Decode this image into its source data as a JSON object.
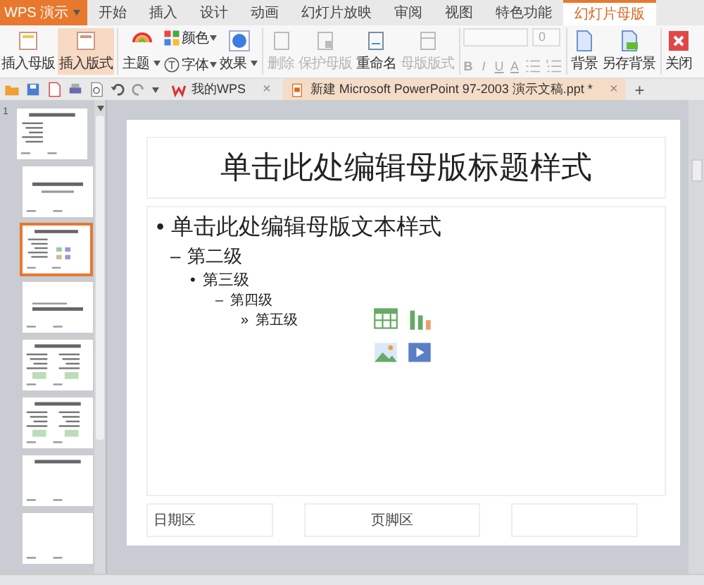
{
  "app_button": {
    "label": "WPS 演示"
  },
  "menu_tabs": [
    {
      "label": "开始",
      "selected": false
    },
    {
      "label": "插入",
      "selected": false
    },
    {
      "label": "设计",
      "selected": false
    },
    {
      "label": "动画",
      "selected": false
    },
    {
      "label": "幻灯片放映",
      "selected": false
    },
    {
      "label": "审阅",
      "selected": false
    },
    {
      "label": "视图",
      "selected": false
    },
    {
      "label": "特色功能",
      "selected": false
    },
    {
      "label": "幻灯片母版",
      "selected": true
    }
  ],
  "ribbon": {
    "master": [
      {
        "label": "插入母版",
        "active": false
      },
      {
        "label": "插入版式",
        "active": true
      }
    ],
    "theme": {
      "main": "主题",
      "colors_label": "颜色",
      "font": "字体",
      "effect": "效果"
    },
    "edit": [
      {
        "label": "删除",
        "disabled": true
      },
      {
        "label": "保护母版",
        "disabled": true
      },
      {
        "label": "重命名",
        "disabled": false
      },
      {
        "label": "母版版式",
        "disabled": true
      }
    ],
    "font": {
      "size": "0",
      "disabled": true,
      "format_buttons": [
        "B",
        "I",
        "U",
        "A"
      ]
    },
    "background": [
      {
        "label": "背景"
      },
      {
        "label": "另存背景"
      }
    ],
    "close": {
      "label": "关闭"
    }
  },
  "doc_tabs": [
    {
      "label": "我的WPS",
      "close": "×",
      "selected": false
    },
    {
      "label": "新建 Microsoft PowerPoint 97-2003 演示文稿.ppt *",
      "close": "×",
      "selected": true
    }
  ],
  "new_tab": "+",
  "thumbnails": [
    {
      "number": "1",
      "kind": "master",
      "selected": false
    },
    {
      "kind": "title",
      "selected": false
    },
    {
      "kind": "content",
      "selected": true
    },
    {
      "kind": "section",
      "selected": false
    },
    {
      "kind": "two",
      "selected": false
    },
    {
      "kind": "compare",
      "selected": false
    },
    {
      "kind": "titleonly",
      "selected": false
    },
    {
      "kind": "blank",
      "selected": false
    }
  ],
  "slide": {
    "title": "单击此处编辑母版标题样式",
    "body": [
      {
        "bullet": "•",
        "text": "单击此处编辑母版文本样式",
        "children": [
          {
            "bullet": "–",
            "text": "第二级",
            "children": [
              {
                "bullet": "•",
                "text": "第三级",
                "children": [
                  {
                    "bullet": "–",
                    "text": "第四级",
                    "children": [
                      {
                        "bullet": "»",
                        "text": "第五级"
                      }
                    ]
                  }
                ]
              }
            ]
          }
        ]
      }
    ],
    "footer": [
      "日期区",
      "页脚区"
    ]
  }
}
